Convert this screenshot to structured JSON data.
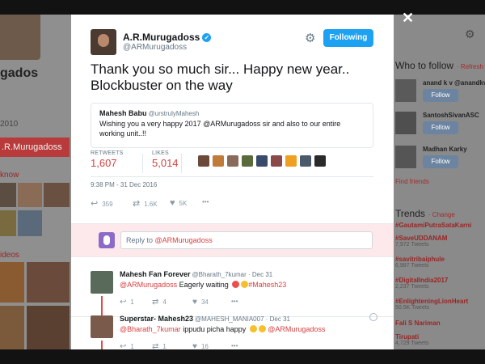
{
  "background": {
    "profile_name": "gados",
    "profile_year": "2010",
    "tweet_to_button": ".R.Murugadoss",
    "you_may_know": "know",
    "videos": "ideos",
    "who_to_follow": {
      "title": "Who to follow",
      "refresh": "· Refresh",
      "accounts": [
        {
          "name": "anand k v @anandkv",
          "follow": "Follow"
        },
        {
          "name": "SantoshSivanASC",
          "follow": "Follow"
        },
        {
          "name": "Madhan Karky",
          "follow": "Follow"
        }
      ],
      "find_friends": "Find friends"
    },
    "trends": {
      "title": "Trends",
      "change": "· Change",
      "items": [
        {
          "tag": "#GautamiPutraSataKarni",
          "count": ""
        },
        {
          "tag": "#SaveUDDANAM",
          "count": "7,972 Tweets"
        },
        {
          "tag": "#savitribaiphule",
          "count": "6,987 Tweets"
        },
        {
          "tag": "#DigitalIndia2017",
          "count": "2,237 Tweets"
        },
        {
          "tag": "#EnlighteningLionHeart",
          "count": "50.5K Tweets"
        },
        {
          "tag": "Fali S Nariman",
          "count": ""
        },
        {
          "tag": "Tirupati",
          "count": "4,729 Tweets"
        }
      ]
    }
  },
  "close_icon": "✕",
  "tweet": {
    "name": "A.R.Murugadoss",
    "handle": "@ARMurugadoss",
    "follow_label": "Following",
    "text": "Thank you so much sir... Happy new year.. Blockbuster on the way",
    "quote": {
      "name": "Mahesh Babu",
      "handle": "@urstrulyMahesh",
      "text": "Wishing you a very happy 2017 @ARMurugadoss sir and also to our entire working unit..!!"
    },
    "retweets_label": "RETWEETS",
    "retweets": "1,607",
    "likes_label": "LIKES",
    "likes": "5,014",
    "timestamp": "9:38 PM - 31 Dec 2016",
    "actions": {
      "replies": "359",
      "retweets": "1.6K",
      "likes": "5K",
      "more": "•••"
    }
  },
  "reply": {
    "prefix": "Reply to ",
    "mention": "@ARMurugadoss"
  },
  "comments": [
    {
      "name": "Mahesh Fan Forever",
      "meta": "@Bharath_7kumar · Dec 31",
      "mention": "@ARMurugadoss",
      "text": " Eagerly waiting ",
      "hashtag": "#Mahesh23",
      "trailing_mention": "",
      "replies": "1",
      "retweets": "4",
      "likes": "34",
      "more": "•••",
      "emoji": [
        "red",
        "yellow"
      ]
    },
    {
      "name": "Superstar- Mahesh23",
      "meta": "@MAHESH_MANIA007 · Dec 31",
      "mention": "@Bharath_7kumar",
      "text": " ippudu picha happy ",
      "hashtag": "",
      "trailing_mention": " @ARMurugadoss",
      "replies": "1",
      "retweets": "1",
      "likes": "16",
      "more": "•••",
      "emoji": [
        "yellow",
        "yellow"
      ]
    }
  ],
  "colors": {
    "accent": "#1da1f2",
    "mention": "#d84040",
    "reply_band": "#fde9eb"
  }
}
